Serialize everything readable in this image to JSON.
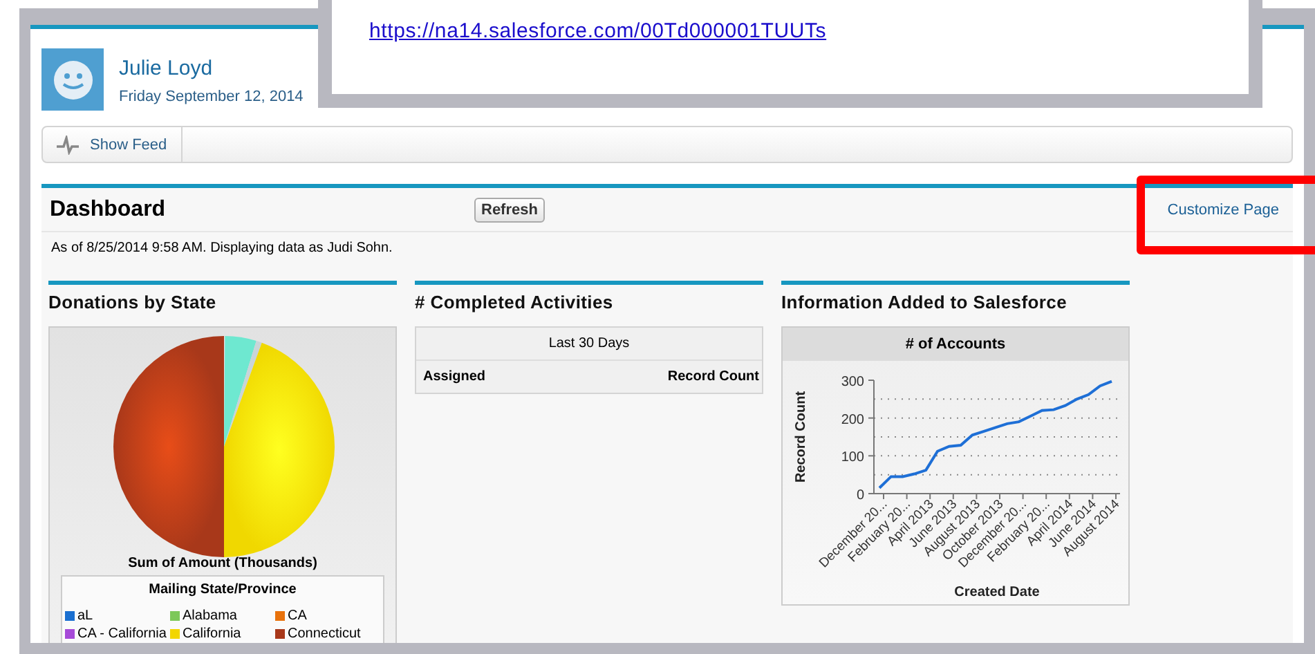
{
  "popup": {
    "url": "https://na14.salesforce.com/00Td000001TUUTs"
  },
  "profile": {
    "name": "Julie Loyd",
    "date": "Friday September 12, 2014"
  },
  "toolbar": {
    "show_feed": "Show Feed"
  },
  "dashboard": {
    "title": "Dashboard",
    "refresh": "Refresh",
    "customize": "Customize Page",
    "highlighted": true,
    "as_of": "As of 8/25/2014 9:58 AM. Displaying data as Judi Sohn."
  },
  "components": [
    {
      "kind": "pie",
      "title": "Donations by State",
      "caption": "Sum of Amount (Thousands)",
      "legend_title": "Mailing State/Province",
      "legend": [
        {
          "label": "aL",
          "color": "#1a6fd0"
        },
        {
          "label": "Alabama",
          "color": "#7dc85a"
        },
        {
          "label": "CA",
          "color": "#e8720c"
        },
        {
          "label": "CA - California",
          "color": "#a64ad8"
        },
        {
          "label": "California",
          "color": "#f2d600"
        },
        {
          "label": "Connecticut",
          "color": "#a8381a"
        }
      ]
    },
    {
      "kind": "table",
      "title": "# Completed Activities",
      "group_header": "Last 30 Days",
      "columns": [
        "Assigned",
        "Record Count"
      ]
    },
    {
      "kind": "line",
      "title": "Information Added to Salesforce",
      "chart_data": {
        "type": "line",
        "title": "# of Accounts",
        "xlabel": "Created Date",
        "ylabel": "Record Count",
        "categories": [
          "December 20...",
          null,
          "February 20...",
          null,
          "April 2013",
          null,
          "June 2013",
          null,
          "August 2013",
          null,
          "October 2013",
          null,
          "December 20...",
          null,
          "February 20...",
          null,
          "April 2014",
          null,
          "June 2014",
          null,
          "August 2014"
        ],
        "series": [
          {
            "color": "#1e6fd6",
            "values": [
              15,
              45,
              45,
              52,
              62,
              112,
              125,
              128,
              155,
              165,
              175,
              185,
              190,
              205,
              220,
              222,
              233,
              250,
              262,
              285,
              297
            ]
          }
        ],
        "ylim": [
          0,
          300
        ],
        "yticks": [
          0,
          100,
          200,
          300
        ]
      }
    }
  ]
}
